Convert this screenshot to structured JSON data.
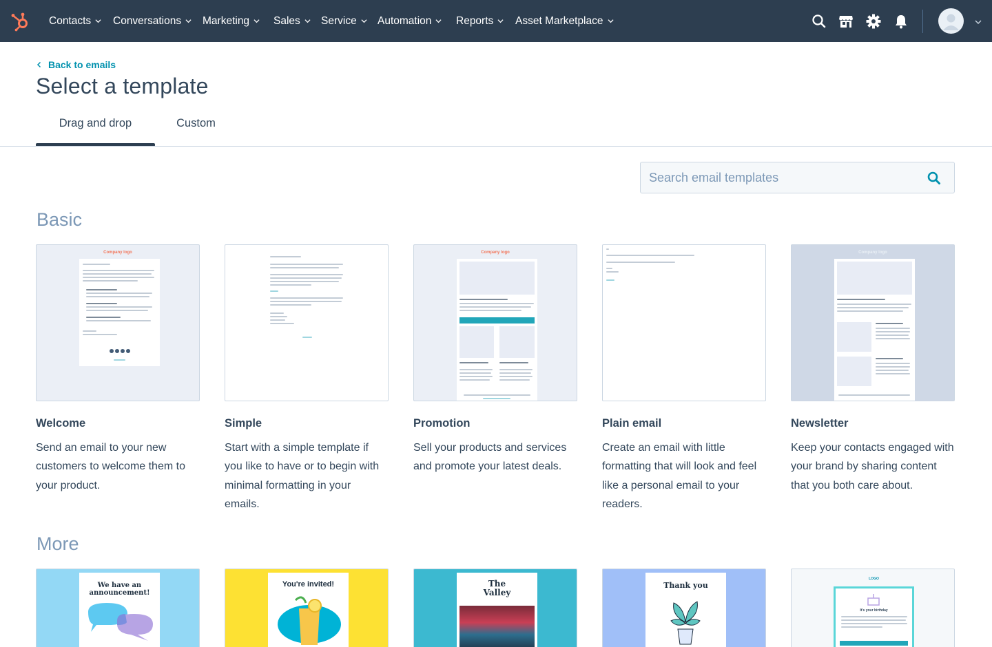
{
  "nav": {
    "items": [
      "Contacts",
      "Conversations",
      "Marketing",
      "Sales",
      "Service",
      "Automation",
      "Reports",
      "Asset Marketplace"
    ],
    "icons": [
      "search-icon",
      "marketplace-icon",
      "gear-icon",
      "bell-icon"
    ]
  },
  "header": {
    "back_link": "Back to emails",
    "title": "Select a template"
  },
  "tabs": [
    {
      "label": "Drag and drop",
      "active": true
    },
    {
      "label": "Custom",
      "active": false
    }
  ],
  "search": {
    "placeholder": "Search email templates"
  },
  "sections": {
    "basic": {
      "title": "Basic",
      "templates": [
        {
          "name": "Welcome",
          "description": "Send an email to your new customers to welcome them to your product."
        },
        {
          "name": "Simple",
          "description": "Start with a simple template if you like to have or to begin with minimal formatting in your emails."
        },
        {
          "name": "Promotion",
          "description": "Sell your products and services and promote your latest deals."
        },
        {
          "name": "Plain email",
          "description": "Create an email with little formatting that will look and feel like a personal email to your readers."
        },
        {
          "name": "Newsletter",
          "description": "Keep your contacts engaged with your brand by sharing content that you both care about."
        }
      ]
    },
    "more": {
      "title": "More",
      "thumbnails": [
        {
          "heading": "We have an announcement!"
        },
        {
          "heading": "You're invited!"
        },
        {
          "heading": "The Valley"
        },
        {
          "heading": "Thank you"
        },
        {
          "heading": "It's your birthday",
          "logo": "LOGO"
        }
      ]
    }
  },
  "thumbs": {
    "company_logo": "Company logo"
  },
  "colors": {
    "nav_bg": "#2d3e50",
    "accent": "#0091ae",
    "brand_orange": "#ff7a59",
    "section_title": "#7c98b6",
    "text": "#33475b"
  }
}
